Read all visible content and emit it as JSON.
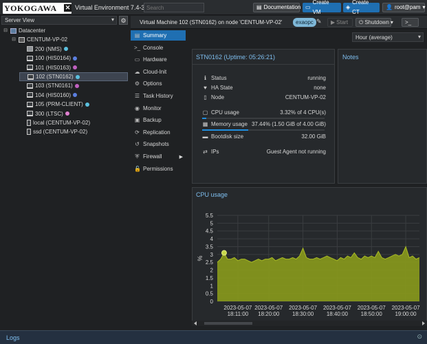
{
  "header": {
    "logo_text": "YOKOGAWA",
    "product": "Virtual Environment 7.4-3",
    "search_placeholder": "Search",
    "documentation": "Documentation",
    "create_vm": "Create VM",
    "create_ct": "Create CT",
    "user": "root@pam"
  },
  "left": {
    "view": "Server View",
    "tree": [
      {
        "label": "Datacenter",
        "level": 0,
        "kind": "datacenter",
        "toggle": "⊟"
      },
      {
        "label": "CENTUM-VP-02",
        "level": 1,
        "kind": "node",
        "toggle": "⊟"
      },
      {
        "label": "200 (NMS)",
        "level": 2,
        "kind": "cube",
        "status": "#5bc0de"
      },
      {
        "label": "100 (HIS0164)",
        "level": 2,
        "kind": "monitor",
        "status": "#5b7fe0"
      },
      {
        "label": "101 (HIS0163)",
        "level": 2,
        "kind": "monitor",
        "status": "#c060c0"
      },
      {
        "label": "102 (STN0162)",
        "level": 2,
        "kind": "monitor",
        "status": "#5bc0de",
        "selected": true
      },
      {
        "label": "103 (STN0161)",
        "level": 2,
        "kind": "monitor",
        "status": "#c060c0"
      },
      {
        "label": "104 (HIS0160)",
        "level": 2,
        "kind": "monitor",
        "status": "#5b7fe0"
      },
      {
        "label": "105 (PRM-CLIENT)",
        "level": 2,
        "kind": "monitor",
        "status": "#5bc0de"
      },
      {
        "label": "300 (LTSC)",
        "level": 2,
        "kind": "monitor",
        "status": "#e080d0"
      },
      {
        "label": "local (CENTUM-VP-02)",
        "level": 2,
        "kind": "storage"
      },
      {
        "label": "ssd (CENTUM-VP-02)",
        "level": 2,
        "kind": "storage"
      }
    ]
  },
  "vm": {
    "title": "Virtual Machine 102 (STN0162) on node 'CENTUM-VP-02'",
    "tag": "exaopc",
    "start": "Start",
    "shutdown": "Shutdown",
    "console": ">_"
  },
  "nav": [
    {
      "label": "Summary",
      "icon": "▤",
      "selected": true
    },
    {
      "label": "Console",
      "icon": ">_"
    },
    {
      "label": "Hardware",
      "icon": "▭"
    },
    {
      "label": "Cloud-Init",
      "icon": "☁"
    },
    {
      "label": "Options",
      "icon": "⚙"
    },
    {
      "label": "Task History",
      "icon": "☰"
    },
    {
      "label": "Monitor",
      "icon": "◉"
    },
    {
      "label": "Backup",
      "icon": "▣"
    },
    {
      "label": "Replication",
      "icon": "⟳"
    },
    {
      "label": "Snapshots",
      "icon": "↺"
    },
    {
      "label": "Firewall",
      "icon": "⛨",
      "submenu": "▶"
    },
    {
      "label": "Permissions",
      "icon": "🔓"
    }
  ],
  "range": "Hour (average)",
  "status": {
    "title": "STN0162 (Uptime: 05:26:21)",
    "rows": [
      {
        "label": "Status",
        "value": "running",
        "icon": "ℹ"
      },
      {
        "label": "HA State",
        "value": "none",
        "icon": "♥"
      },
      {
        "label": "Node",
        "value": "CENTUM-VP-02",
        "icon": "▯"
      },
      {
        "label": "CPU usage",
        "value": "3.32% of 4 CPU(s)",
        "icon": "▢"
      },
      {
        "label": "Memory usage",
        "value": "37.44% (1.50 GiB of 4.00 GiB)",
        "icon": "▦"
      },
      {
        "label": "Bootdisk size",
        "value": "32.00 GiB",
        "icon": "▬"
      },
      {
        "label": "IPs",
        "value": "Guest Agent not running",
        "icon": "⇄"
      }
    ],
    "cpu_fraction": 0.0332,
    "memory_fraction": 0.3744
  },
  "notes_title": "Notes",
  "logs_title": "Logs",
  "colors": {
    "accent": "#1f6fb2",
    "title_blue": "#7fbff0",
    "area_fill": "#8a9a1c",
    "area_line": "#a9bb24"
  },
  "chart_data": {
    "type": "area",
    "title": "CPU usage",
    "xlabel": "",
    "ylabel": "%",
    "ylim": [
      0,
      5.5
    ],
    "yticks": [
      0,
      0.5,
      1,
      1.5,
      2,
      2.5,
      3,
      3.5,
      4,
      4.5,
      5,
      5.5
    ],
    "xlim": [
      "2023-05-07 18:05",
      "2023-05-07 19:04"
    ],
    "xticks": [
      {
        "date": "2023-05-07",
        "time": "18:11:00",
        "at": "2023-05-07 18:11"
      },
      {
        "date": "2023-05-07",
        "time": "18:20:00",
        "at": "2023-05-07 18:20"
      },
      {
        "date": "2023-05-07",
        "time": "18:30:00",
        "at": "2023-05-07 18:30"
      },
      {
        "date": "2023-05-07",
        "time": "18:40:00",
        "at": "2023-05-07 18:40"
      },
      {
        "date": "2023-05-07",
        "time": "18:50:00",
        "at": "2023-05-07 18:50"
      },
      {
        "date": "2023-05-07",
        "time": "19:00:00",
        "at": "2023-05-07 19:00"
      }
    ],
    "grid": true,
    "series": [
      {
        "x": [
          "2023-05-07 18:05",
          "2023-05-07 18:06",
          "2023-05-07 18:07",
          "2023-05-07 18:08",
          "2023-05-07 18:09",
          "2023-05-07 18:10",
          "2023-05-07 18:11",
          "2023-05-07 18:12",
          "2023-05-07 18:13",
          "2023-05-07 18:14",
          "2023-05-07 18:15",
          "2023-05-07 18:16",
          "2023-05-07 18:17",
          "2023-05-07 18:18",
          "2023-05-07 18:19",
          "2023-05-07 18:20",
          "2023-05-07 18:21",
          "2023-05-07 18:22",
          "2023-05-07 18:23",
          "2023-05-07 18:24",
          "2023-05-07 18:25",
          "2023-05-07 18:26",
          "2023-05-07 18:27",
          "2023-05-07 18:28",
          "2023-05-07 18:29",
          "2023-05-07 18:30",
          "2023-05-07 18:31",
          "2023-05-07 18:32",
          "2023-05-07 18:33",
          "2023-05-07 18:34",
          "2023-05-07 18:35",
          "2023-05-07 18:36",
          "2023-05-07 18:37",
          "2023-05-07 18:38",
          "2023-05-07 18:39",
          "2023-05-07 18:40",
          "2023-05-07 18:41",
          "2023-05-07 18:42",
          "2023-05-07 18:43",
          "2023-05-07 18:44",
          "2023-05-07 18:45",
          "2023-05-07 18:46",
          "2023-05-07 18:47",
          "2023-05-07 18:48",
          "2023-05-07 18:49",
          "2023-05-07 18:50",
          "2023-05-07 18:51",
          "2023-05-07 18:52",
          "2023-05-07 18:53",
          "2023-05-07 18:54",
          "2023-05-07 18:55",
          "2023-05-07 18:56",
          "2023-05-07 18:57",
          "2023-05-07 18:58",
          "2023-05-07 18:59",
          "2023-05-07 19:00",
          "2023-05-07 19:01",
          "2023-05-07 19:02",
          "2023-05-07 19:03",
          "2023-05-07 19:04"
        ],
        "values": [
          2.5,
          2.7,
          3.1,
          2.7,
          2.7,
          2.8,
          2.6,
          2.7,
          2.7,
          2.6,
          2.5,
          2.6,
          2.7,
          2.6,
          2.7,
          2.7,
          2.8,
          2.6,
          2.7,
          2.8,
          2.7,
          2.7,
          2.8,
          2.7,
          2.9,
          3.4,
          2.8,
          2.7,
          2.7,
          2.8,
          2.7,
          2.8,
          2.9,
          2.8,
          2.7,
          2.6,
          2.8,
          2.7,
          2.9,
          2.8,
          3.1,
          2.8,
          2.7,
          2.9,
          2.8,
          2.9,
          2.8,
          3.2,
          2.8,
          2.7,
          2.8,
          2.9,
          3.0,
          2.9,
          3.0,
          3.5,
          2.8,
          2.9,
          2.7,
          2.8
        ]
      }
    ],
    "highlight": {
      "x": "2023-05-07 18:07",
      "y": 3.1
    }
  }
}
